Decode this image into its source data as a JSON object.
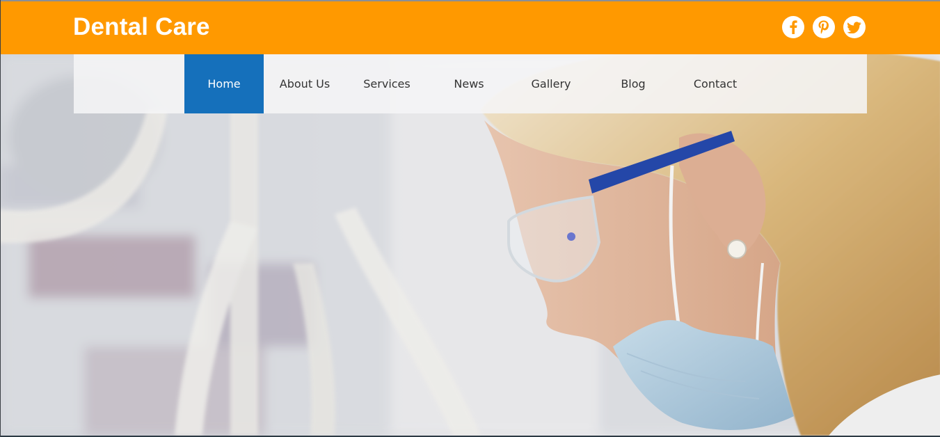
{
  "header": {
    "brand": "Dental Care",
    "social": [
      {
        "icon": "facebook-icon",
        "label": "f"
      },
      {
        "icon": "pinterest-icon",
        "label": "P"
      },
      {
        "icon": "twitter-icon",
        "label": "t"
      }
    ]
  },
  "nav": {
    "items": [
      {
        "label": "Home",
        "active": true
      },
      {
        "label": "About Us",
        "active": false
      },
      {
        "label": "Services",
        "active": false
      },
      {
        "label": "News",
        "active": false
      },
      {
        "label": "Gallery",
        "active": false
      },
      {
        "label": "Blog",
        "active": false
      },
      {
        "label": "Contact",
        "active": false
      }
    ],
    "active_color": "#1570bb"
  },
  "theme": {
    "header_bg": "#ff9900",
    "header_text": "#ffffff"
  }
}
